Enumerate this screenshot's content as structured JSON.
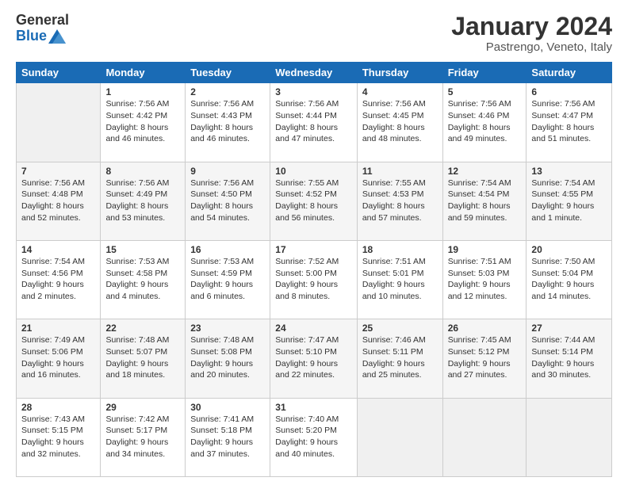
{
  "header": {
    "logo_general": "General",
    "logo_blue": "Blue",
    "month_title": "January 2024",
    "location": "Pastrengo, Veneto, Italy"
  },
  "days_of_week": [
    "Sunday",
    "Monday",
    "Tuesday",
    "Wednesday",
    "Thursday",
    "Friday",
    "Saturday"
  ],
  "weeks": [
    [
      {
        "day": "",
        "sunrise": "",
        "sunset": "",
        "daylight": ""
      },
      {
        "day": "1",
        "sunrise": "Sunrise: 7:56 AM",
        "sunset": "Sunset: 4:42 PM",
        "daylight": "Daylight: 8 hours and 46 minutes."
      },
      {
        "day": "2",
        "sunrise": "Sunrise: 7:56 AM",
        "sunset": "Sunset: 4:43 PM",
        "daylight": "Daylight: 8 hours and 46 minutes."
      },
      {
        "day": "3",
        "sunrise": "Sunrise: 7:56 AM",
        "sunset": "Sunset: 4:44 PM",
        "daylight": "Daylight: 8 hours and 47 minutes."
      },
      {
        "day": "4",
        "sunrise": "Sunrise: 7:56 AM",
        "sunset": "Sunset: 4:45 PM",
        "daylight": "Daylight: 8 hours and 48 minutes."
      },
      {
        "day": "5",
        "sunrise": "Sunrise: 7:56 AM",
        "sunset": "Sunset: 4:46 PM",
        "daylight": "Daylight: 8 hours and 49 minutes."
      },
      {
        "day": "6",
        "sunrise": "Sunrise: 7:56 AM",
        "sunset": "Sunset: 4:47 PM",
        "daylight": "Daylight: 8 hours and 51 minutes."
      }
    ],
    [
      {
        "day": "7",
        "sunrise": "Sunrise: 7:56 AM",
        "sunset": "Sunset: 4:48 PM",
        "daylight": "Daylight: 8 hours and 52 minutes."
      },
      {
        "day": "8",
        "sunrise": "Sunrise: 7:56 AM",
        "sunset": "Sunset: 4:49 PM",
        "daylight": "Daylight: 8 hours and 53 minutes."
      },
      {
        "day": "9",
        "sunrise": "Sunrise: 7:56 AM",
        "sunset": "Sunset: 4:50 PM",
        "daylight": "Daylight: 8 hours and 54 minutes."
      },
      {
        "day": "10",
        "sunrise": "Sunrise: 7:55 AM",
        "sunset": "Sunset: 4:52 PM",
        "daylight": "Daylight: 8 hours and 56 minutes."
      },
      {
        "day": "11",
        "sunrise": "Sunrise: 7:55 AM",
        "sunset": "Sunset: 4:53 PM",
        "daylight": "Daylight: 8 hours and 57 minutes."
      },
      {
        "day": "12",
        "sunrise": "Sunrise: 7:54 AM",
        "sunset": "Sunset: 4:54 PM",
        "daylight": "Daylight: 8 hours and 59 minutes."
      },
      {
        "day": "13",
        "sunrise": "Sunrise: 7:54 AM",
        "sunset": "Sunset: 4:55 PM",
        "daylight": "Daylight: 9 hours and 1 minute."
      }
    ],
    [
      {
        "day": "14",
        "sunrise": "Sunrise: 7:54 AM",
        "sunset": "Sunset: 4:56 PM",
        "daylight": "Daylight: 9 hours and 2 minutes."
      },
      {
        "day": "15",
        "sunrise": "Sunrise: 7:53 AM",
        "sunset": "Sunset: 4:58 PM",
        "daylight": "Daylight: 9 hours and 4 minutes."
      },
      {
        "day": "16",
        "sunrise": "Sunrise: 7:53 AM",
        "sunset": "Sunset: 4:59 PM",
        "daylight": "Daylight: 9 hours and 6 minutes."
      },
      {
        "day": "17",
        "sunrise": "Sunrise: 7:52 AM",
        "sunset": "Sunset: 5:00 PM",
        "daylight": "Daylight: 9 hours and 8 minutes."
      },
      {
        "day": "18",
        "sunrise": "Sunrise: 7:51 AM",
        "sunset": "Sunset: 5:01 PM",
        "daylight": "Daylight: 9 hours and 10 minutes."
      },
      {
        "day": "19",
        "sunrise": "Sunrise: 7:51 AM",
        "sunset": "Sunset: 5:03 PM",
        "daylight": "Daylight: 9 hours and 12 minutes."
      },
      {
        "day": "20",
        "sunrise": "Sunrise: 7:50 AM",
        "sunset": "Sunset: 5:04 PM",
        "daylight": "Daylight: 9 hours and 14 minutes."
      }
    ],
    [
      {
        "day": "21",
        "sunrise": "Sunrise: 7:49 AM",
        "sunset": "Sunset: 5:06 PM",
        "daylight": "Daylight: 9 hours and 16 minutes."
      },
      {
        "day": "22",
        "sunrise": "Sunrise: 7:48 AM",
        "sunset": "Sunset: 5:07 PM",
        "daylight": "Daylight: 9 hours and 18 minutes."
      },
      {
        "day": "23",
        "sunrise": "Sunrise: 7:48 AM",
        "sunset": "Sunset: 5:08 PM",
        "daylight": "Daylight: 9 hours and 20 minutes."
      },
      {
        "day": "24",
        "sunrise": "Sunrise: 7:47 AM",
        "sunset": "Sunset: 5:10 PM",
        "daylight": "Daylight: 9 hours and 22 minutes."
      },
      {
        "day": "25",
        "sunrise": "Sunrise: 7:46 AM",
        "sunset": "Sunset: 5:11 PM",
        "daylight": "Daylight: 9 hours and 25 minutes."
      },
      {
        "day": "26",
        "sunrise": "Sunrise: 7:45 AM",
        "sunset": "Sunset: 5:12 PM",
        "daylight": "Daylight: 9 hours and 27 minutes."
      },
      {
        "day": "27",
        "sunrise": "Sunrise: 7:44 AM",
        "sunset": "Sunset: 5:14 PM",
        "daylight": "Daylight: 9 hours and 30 minutes."
      }
    ],
    [
      {
        "day": "28",
        "sunrise": "Sunrise: 7:43 AM",
        "sunset": "Sunset: 5:15 PM",
        "daylight": "Daylight: 9 hours and 32 minutes."
      },
      {
        "day": "29",
        "sunrise": "Sunrise: 7:42 AM",
        "sunset": "Sunset: 5:17 PM",
        "daylight": "Daylight: 9 hours and 34 minutes."
      },
      {
        "day": "30",
        "sunrise": "Sunrise: 7:41 AM",
        "sunset": "Sunset: 5:18 PM",
        "daylight": "Daylight: 9 hours and 37 minutes."
      },
      {
        "day": "31",
        "sunrise": "Sunrise: 7:40 AM",
        "sunset": "Sunset: 5:20 PM",
        "daylight": "Daylight: 9 hours and 40 minutes."
      },
      {
        "day": "",
        "sunrise": "",
        "sunset": "",
        "daylight": ""
      },
      {
        "day": "",
        "sunrise": "",
        "sunset": "",
        "daylight": ""
      },
      {
        "day": "",
        "sunrise": "",
        "sunset": "",
        "daylight": ""
      }
    ]
  ]
}
